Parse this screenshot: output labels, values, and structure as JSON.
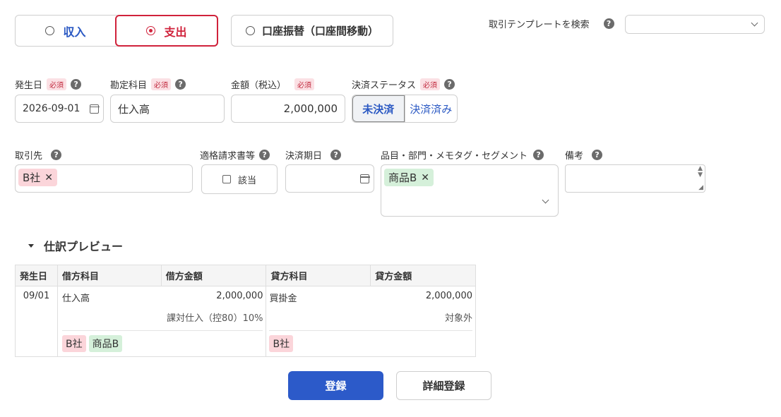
{
  "type_toggle": {
    "income": "収入",
    "expense": "支出",
    "transfer": "口座振替（口座間移動）"
  },
  "template": {
    "label": "取引テンプレートを検索",
    "value": ""
  },
  "help_glyph": "?",
  "required_badge": "必須",
  "fields": {
    "date": {
      "label": "発生日",
      "value": "2026-09-01"
    },
    "account": {
      "label": "勘定科目",
      "value": "仕入高"
    },
    "amount": {
      "label": "金額（税込）",
      "value": "2,000,000"
    },
    "status": {
      "label": "決済ステータス",
      "options": [
        "未決済",
        "決済済み"
      ]
    },
    "partner": {
      "label": "取引先",
      "chip": "B社"
    },
    "invoice": {
      "label": "適格請求書等",
      "checkbox_label": "該当"
    },
    "due": {
      "label": "決済期日",
      "value": ""
    },
    "item": {
      "label": "品目・部門・メモタグ・セグメント",
      "chip": "商品B"
    },
    "note": {
      "label": "備考",
      "value": ""
    }
  },
  "preview": {
    "title": "仕訳プレビュー",
    "headers": [
      "発生日",
      "借方科目",
      "借方金額",
      "貸方科目",
      "貸方金額"
    ],
    "row": {
      "date": "09/01",
      "debit_account": "仕入高",
      "debit_amount": "2,000,000",
      "debit_tax": "課対仕入（控80）10%",
      "debit_tags": [
        "B社",
        "商品B"
      ],
      "credit_account": "買掛金",
      "credit_amount": "2,000,000",
      "credit_tax": "対象外",
      "credit_tags": [
        "B社"
      ]
    }
  },
  "buttons": {
    "register": "登録",
    "detail_register": "詳細登録"
  },
  "colors": {
    "accent": "#2c5ac9",
    "danger": "#d0223b"
  }
}
